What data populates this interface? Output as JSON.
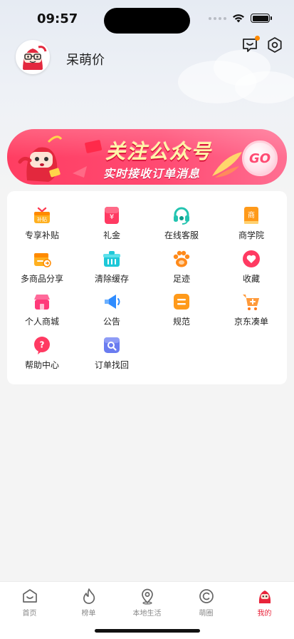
{
  "status_bar": {
    "time": "09:57",
    "wifi_icon": "wifi-icon",
    "battery_icon": "battery-icon"
  },
  "header": {
    "username": "呆萌价",
    "avatar_icon": "mascot-avatar",
    "message_icon": "message-icon",
    "settings_icon": "settings-icon",
    "message_badge_color": "#ff8a00"
  },
  "banner": {
    "title": "关注公众号",
    "subtitle": "实时接收订单消息",
    "go_label": "GO"
  },
  "features": [
    {
      "label": "专享补贴",
      "icon": "subsidy-icon",
      "icon_text": "补贴"
    },
    {
      "label": "礼金",
      "icon": "gift-money-icon",
      "icon_text": "¥"
    },
    {
      "label": "在线客服",
      "icon": "headset-icon",
      "icon_text": ""
    },
    {
      "label": "商学院",
      "icon": "business-school-icon",
      "icon_text": "商"
    },
    {
      "label": "多商品分享",
      "icon": "multi-share-icon",
      "icon_text": ""
    },
    {
      "label": "清除缓存",
      "icon": "clear-cache-icon",
      "icon_text": ""
    },
    {
      "label": "足迹",
      "icon": "footprint-icon",
      "icon_text": ""
    },
    {
      "label": "收藏",
      "icon": "favorite-icon",
      "icon_text": ""
    },
    {
      "label": "个人商城",
      "icon": "personal-mall-icon",
      "icon_text": ""
    },
    {
      "label": "公告",
      "icon": "announcement-icon",
      "icon_text": ""
    },
    {
      "label": "规范",
      "icon": "rules-icon",
      "icon_text": ""
    },
    {
      "label": "京东凑单",
      "icon": "jd-cart-icon",
      "icon_text": ""
    },
    {
      "label": "帮助中心",
      "icon": "help-icon",
      "icon_text": "?"
    },
    {
      "label": "订单找回",
      "icon": "order-search-icon",
      "icon_text": ""
    }
  ],
  "tabbar": [
    {
      "label": "首页",
      "icon": "home-icon",
      "active": false
    },
    {
      "label": "榜单",
      "icon": "flame-icon",
      "active": false
    },
    {
      "label": "本地生活",
      "icon": "location-icon",
      "active": false
    },
    {
      "label": "萌圈",
      "icon": "circle-icon",
      "active": false
    },
    {
      "label": "我的",
      "icon": "profile-icon",
      "active": true
    }
  ],
  "colors": {
    "accent": "#e8233a",
    "banner": "#ff4a72",
    "inactive_tab": "#888888"
  }
}
